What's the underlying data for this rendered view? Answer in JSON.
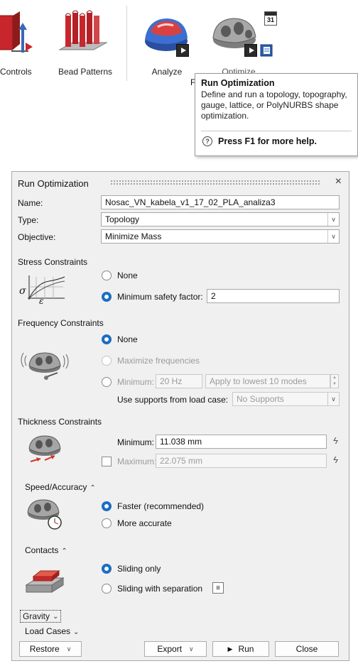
{
  "ribbon": {
    "tools": [
      {
        "label": "Controls",
        "icon": "controls-icon"
      },
      {
        "label": "Bead Patterns",
        "icon": "bead-patterns-icon"
      },
      {
        "label": "Analyze",
        "icon": "analyze-icon"
      },
      {
        "label": "Optimize",
        "icon": "optimize-icon"
      }
    ],
    "partial_label": "F",
    "calendar_day": "31"
  },
  "tooltip": {
    "title": "Run Optimization",
    "body": "Define and run a topology, topography, gauge, lattice, or PolyNURBS shape optimization.",
    "help_text": "Press F1 for more help.",
    "help_glyph": "?"
  },
  "dialog": {
    "title": "Run Optimization",
    "close_glyph": "×",
    "name_label": "Name:",
    "name_value": "Nosac_VN_kabela_v1_17_02_PLA_analiza3",
    "type_label": "Type:",
    "type_value": "Topology",
    "objective_label": "Objective:",
    "objective_value": "Minimize Mass",
    "stress": {
      "title": "Stress Constraints",
      "none": "None",
      "min_safety": "Minimum safety factor:",
      "safety_value": "2",
      "selected": "min_safety"
    },
    "frequency": {
      "title": "Frequency Constraints",
      "none": "None",
      "maximize": "Maximize frequencies",
      "minimum": "Minimum:",
      "min_value": "20 Hz",
      "apply_lowest": "Apply to lowest 10 modes",
      "supports_label": "Use supports from load case:",
      "supports_value": "No Supports",
      "selected": "none"
    },
    "thickness": {
      "title": "Thickness Constraints",
      "minimum_label": "Minimum:",
      "minimum_value": "11.038 mm",
      "maximum_label": "Maximum:",
      "maximum_value": "22.075 mm",
      "maximum_checked": false
    },
    "speed": {
      "title": "Speed/Accuracy",
      "faster": "Faster (recommended)",
      "accurate": "More accurate",
      "selected": "faster"
    },
    "contacts": {
      "title": "Contacts",
      "sliding_only": "Sliding only",
      "sliding_sep": "Sliding with separation",
      "selected": "sliding_only"
    },
    "gravity_label": "Gravity",
    "load_cases_label": "Load Cases",
    "buttons": {
      "restore": "Restore",
      "export": "Export",
      "run": "Run",
      "close": "Close"
    }
  },
  "colors": {
    "accent": "#1b6ec2",
    "dialog_bg": "#f0f0f0",
    "bead_red": "#c8262d",
    "arrow_red": "#d2332a"
  }
}
